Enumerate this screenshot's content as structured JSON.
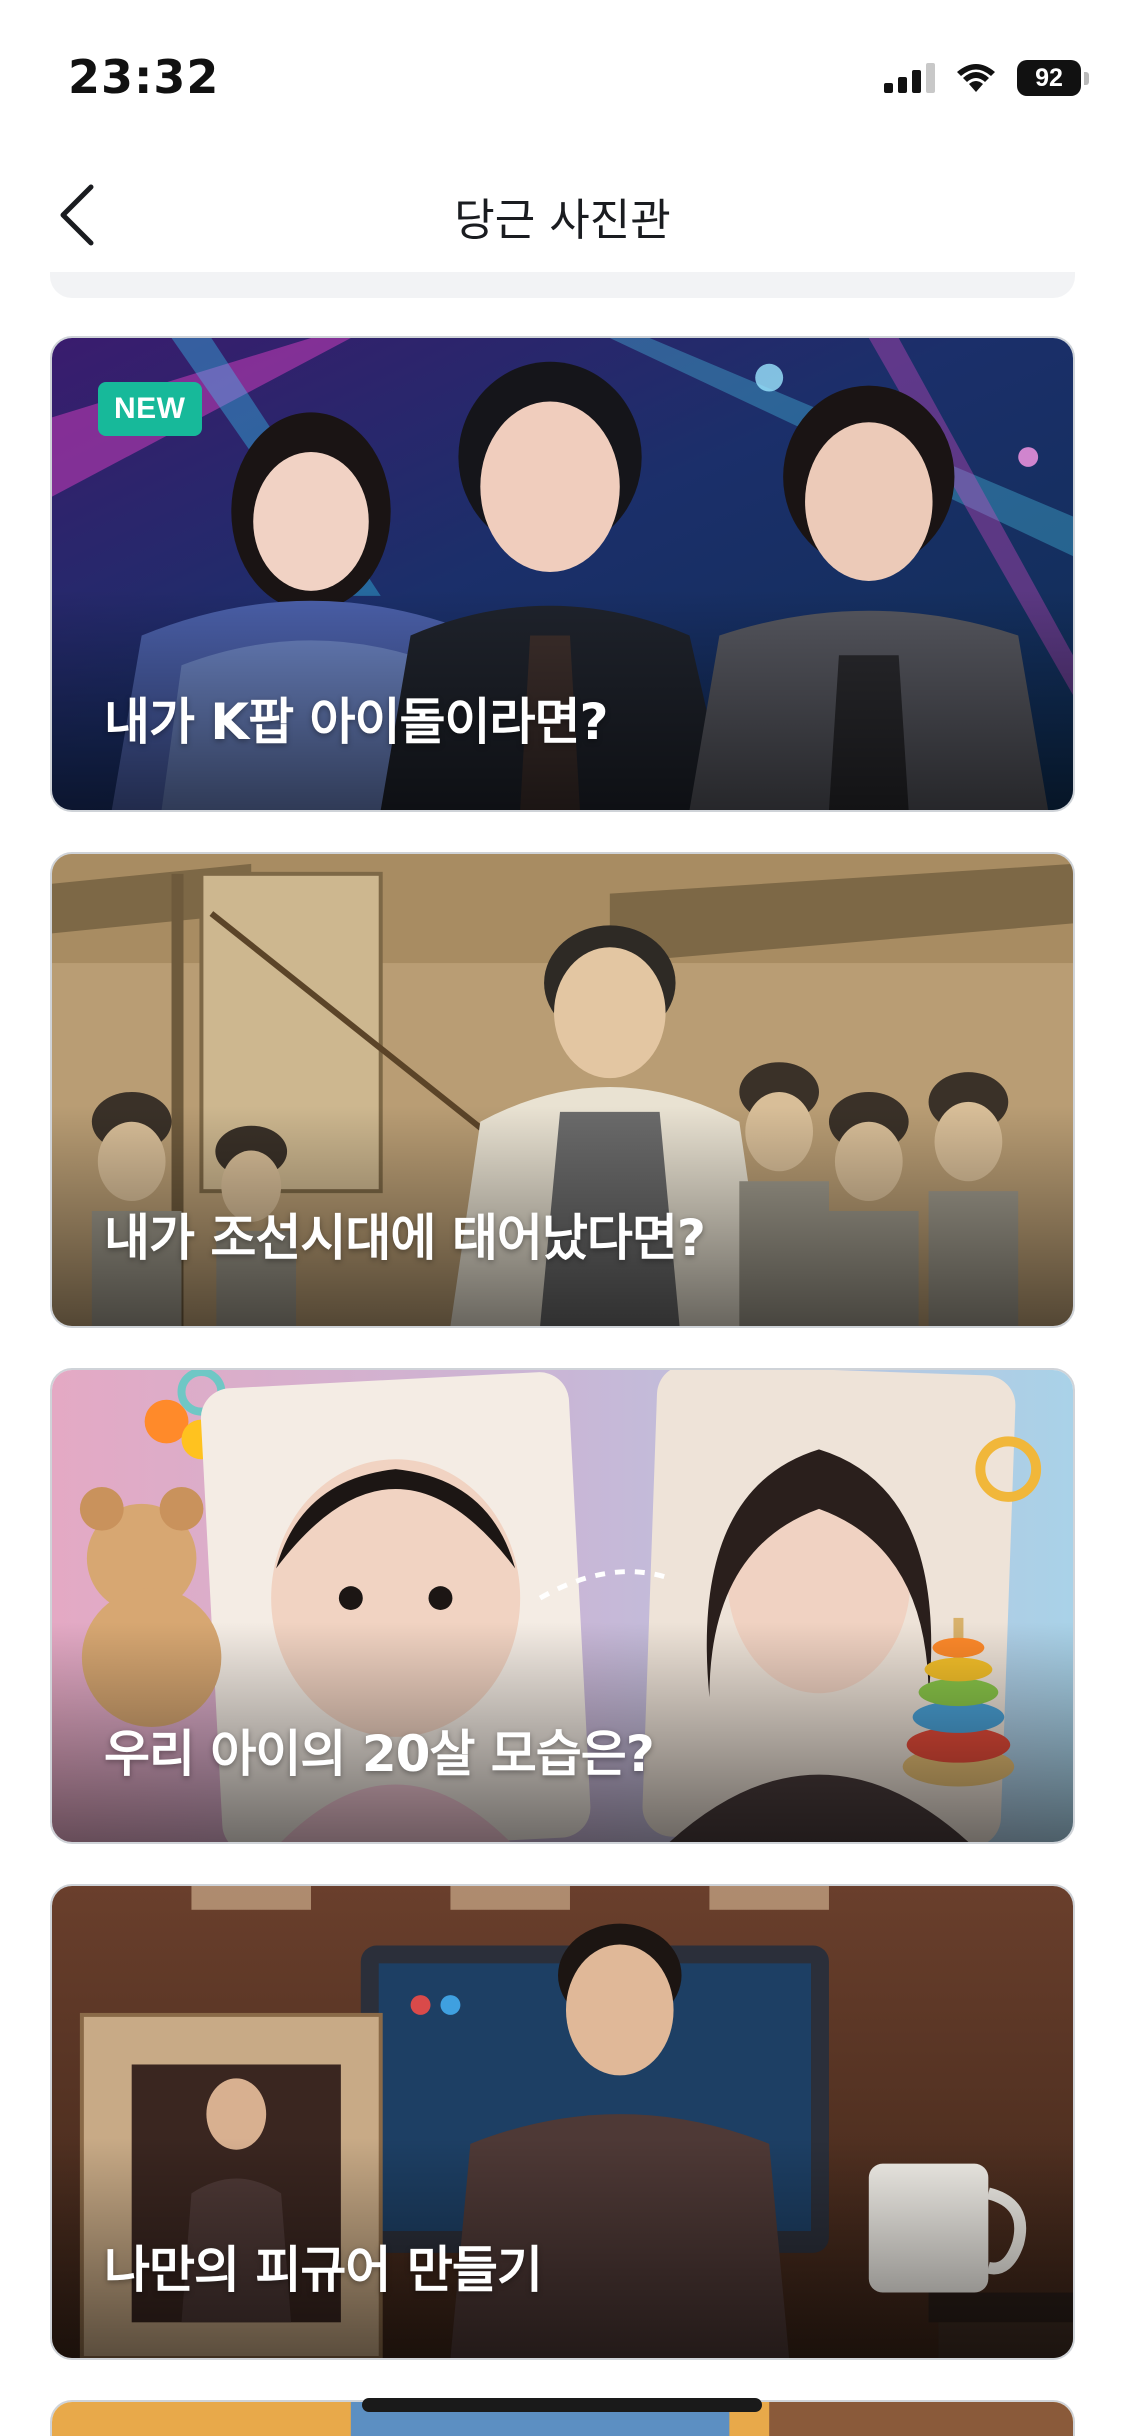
{
  "status_bar": {
    "time": "23:32",
    "battery": "92",
    "icons": [
      "cellular-signal-icon",
      "wifi-icon",
      "battery-icon"
    ]
  },
  "nav": {
    "title": "당근 사진관",
    "back_icon": "chevron-left-icon"
  },
  "cards": [
    {
      "title": "내가 K팝 아이돌이라면?",
      "badge": "NEW",
      "image": "kpop-idol-stage-photo"
    },
    {
      "title": "내가 조선시대에 태어났다면?",
      "badge": "",
      "image": "joseon-era-illustration"
    },
    {
      "title": "우리 아이의 20살 모습은?",
      "badge": "",
      "image": "baby-to-adult-photo"
    },
    {
      "title": "나만의 피규어 만들기",
      "badge": "",
      "image": "custom-figure-photo"
    }
  ],
  "colors": {
    "accent_badge": "#17b99a",
    "text_primary": "#1a1c20",
    "card_border": "#cfd3d8"
  }
}
